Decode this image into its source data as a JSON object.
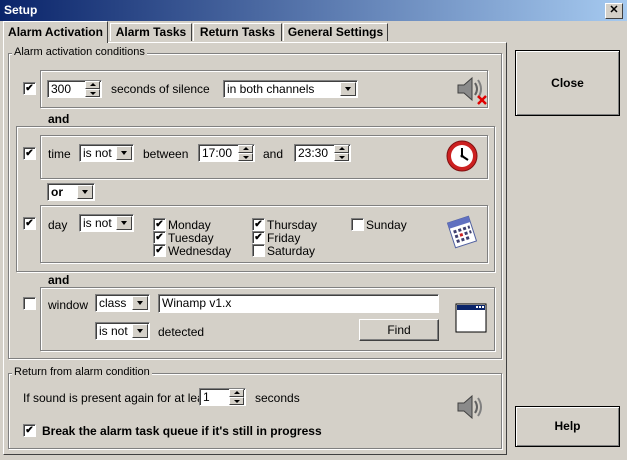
{
  "window": {
    "title": "Setup",
    "close_glyph": "✕"
  },
  "tabs": [
    {
      "label": "Alarm Activation",
      "active": true
    },
    {
      "label": "Alarm Tasks",
      "active": false
    },
    {
      "label": "Return Tasks",
      "active": false
    },
    {
      "label": "General Settings",
      "active": false
    }
  ],
  "activation": {
    "group_label": "Alarm activation conditions",
    "silence": {
      "checked": true,
      "seconds_value": "300",
      "seconds_label": "seconds of silence",
      "channel_selected": "in both channels",
      "icon": "speaker-muted-icon"
    },
    "and_1": "and",
    "time": {
      "checked": true,
      "label": "time",
      "mode": "is not",
      "between_label": "between",
      "from": "17:00",
      "and_label": "and",
      "to": "23:30",
      "icon": "clock-icon"
    },
    "or_selected": "or",
    "day": {
      "checked": true,
      "label": "day",
      "mode": "is not",
      "days": [
        {
          "name": "Monday",
          "checked": true
        },
        {
          "name": "Tuesday",
          "checked": true
        },
        {
          "name": "Wednesday",
          "checked": true
        },
        {
          "name": "Thursday",
          "checked": true
        },
        {
          "name": "Friday",
          "checked": true
        },
        {
          "name": "Saturday",
          "checked": false
        },
        {
          "name": "Sunday",
          "checked": false
        }
      ],
      "icon": "calendar-icon"
    },
    "and_2": "and",
    "window": {
      "checked": false,
      "label": "window",
      "match_by": "class",
      "value": "Winamp v1.x",
      "mode": "is not",
      "detected_label": "detected",
      "find_label": "Find",
      "icon": "window-icon"
    }
  },
  "return": {
    "group_label": "Return from alarm condition",
    "sound_label": "If sound is present again for at least",
    "sound_value": "1",
    "seconds_label": "seconds",
    "break_checked": true,
    "break_label": "Break the alarm task queue if it's still in progress",
    "icon": "speaker-icon"
  },
  "buttons": {
    "close": "Close",
    "help": "Help"
  },
  "colors": {
    "titlebar": "#0a246a",
    "face": "#d4d0c8",
    "clock_red": "#cc2020",
    "mute_x": "#e00000"
  }
}
